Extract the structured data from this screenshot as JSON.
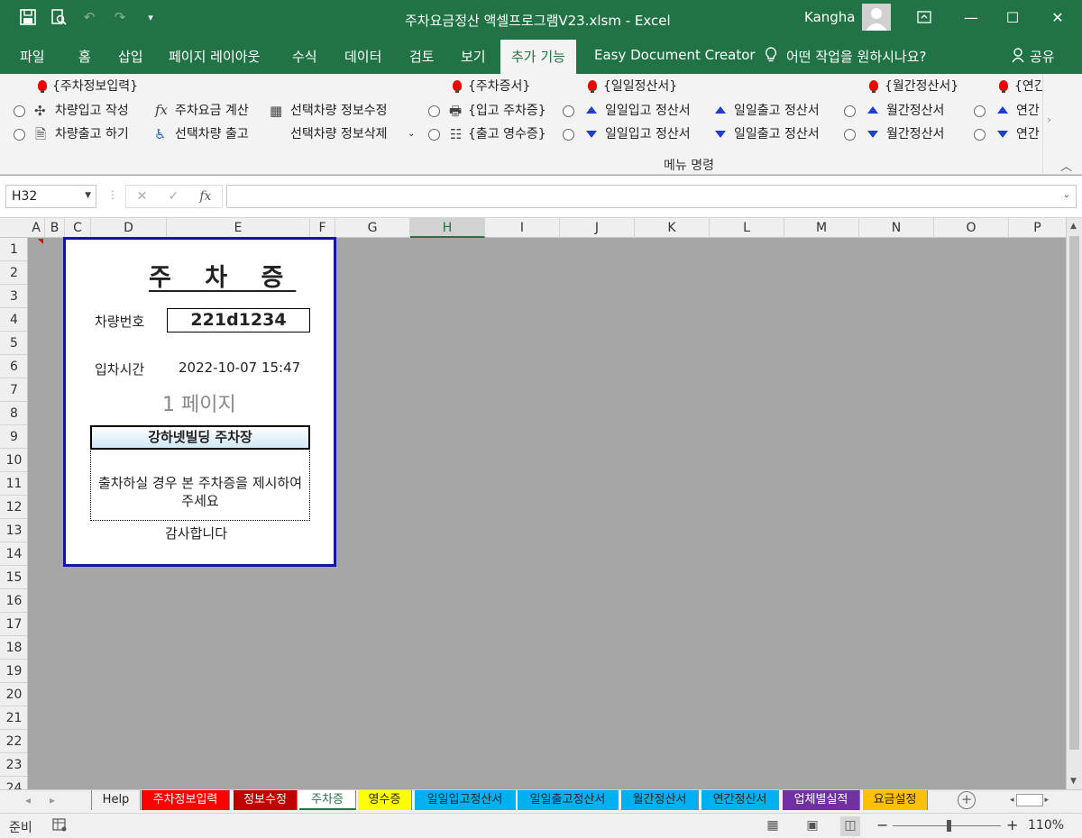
{
  "window": {
    "title": "주차요금정산 액셀프로그램V23.xlsm  -  Excel",
    "user": "Kangha"
  },
  "menus": [
    "파일",
    "홈",
    "삽입",
    "페이지 레이아웃",
    "수식",
    "데이터",
    "검토",
    "보기",
    "추가 기능",
    "Easy Document Creator",
    "어떤 작업을 원하시나요?",
    "공유"
  ],
  "active_menu": "추가 기능",
  "ribbon": {
    "group1": {
      "title": "{주차정보입력}",
      "btn1": "차량입고 작성",
      "btn2": "주차요금 계산",
      "btn3": "선택차량 정보수정",
      "btn4": "차량출고 하기",
      "btn5": "선택차량 출고",
      "btn6": "선택차량 정보삭제"
    },
    "group2": {
      "title": "{주차증서}",
      "btn1": "{입고 주차증}",
      "btn2": "{출고 영수증}"
    },
    "group3": {
      "title": "{일일정산서}",
      "btn1": "일일입고 정산서",
      "btn2": "일일출고 정산서",
      "btn3": "일일입고 정산서",
      "btn4": "일일출고 정산서"
    },
    "group4": {
      "title": "{월간정산서}",
      "btn1": "월간정산서",
      "btn2": "월간정산서"
    },
    "group5": {
      "title": "{연간",
      "btn1": "연간",
      "btn2": "연간"
    },
    "group_label": "메뉴 명령"
  },
  "formula": {
    "namebox": "H32",
    "fx": "fx",
    "value": ""
  },
  "columns": [
    "A",
    "B",
    "C",
    "D",
    "E",
    "F",
    "G",
    "H",
    "I",
    "J",
    "K",
    "L",
    "M",
    "N",
    "O",
    "P"
  ],
  "selected_column": "H",
  "rows": [
    "1",
    "2",
    "3",
    "4",
    "5",
    "6",
    "7",
    "8",
    "9",
    "10",
    "11",
    "12",
    "13",
    "14",
    "15",
    "16",
    "17",
    "18",
    "19",
    "20",
    "21",
    "22",
    "23",
    "24"
  ],
  "card": {
    "title": "주 차 증",
    "vehicle_label": "차량번호",
    "vehicle_number": "221d1234",
    "entry_label": "입차시간",
    "entry_time": "2022-10-07 15:47",
    "page": "1 페이지",
    "lot_name": "강하넷빌딩 주차장",
    "notice": "출차하실 경우 본 주차증을 제시하여 주세요",
    "thanks": "감사합니다"
  },
  "sheets": [
    {
      "name": "Help",
      "color": "#f0f0f0",
      "fg": "#333"
    },
    {
      "name": "주차정보입력",
      "color": "#ff0000",
      "fg": "#ffffff"
    },
    {
      "name": "정보수정",
      "color": "#c00000",
      "fg": "#ffffff"
    },
    {
      "name": "주차증",
      "color": "#ffffff",
      "fg": "#217346"
    },
    {
      "name": "영수증",
      "color": "#ffff00",
      "fg": "#333"
    },
    {
      "name": "일일입고정산서",
      "color": "#00b0f0",
      "fg": "#333"
    },
    {
      "name": "일일출고정산서",
      "color": "#00b0f0",
      "fg": "#333"
    },
    {
      "name": "월간정산서",
      "color": "#00b0f0",
      "fg": "#333"
    },
    {
      "name": "연간정산서",
      "color": "#00b0f0",
      "fg": "#333"
    },
    {
      "name": "업체별실적",
      "color": "#7030a0",
      "fg": "#ffffff"
    },
    {
      "name": "요금설정",
      "color": "#ffc000",
      "fg": "#333"
    }
  ],
  "status": {
    "mode": "준비",
    "zoom": "110%"
  }
}
